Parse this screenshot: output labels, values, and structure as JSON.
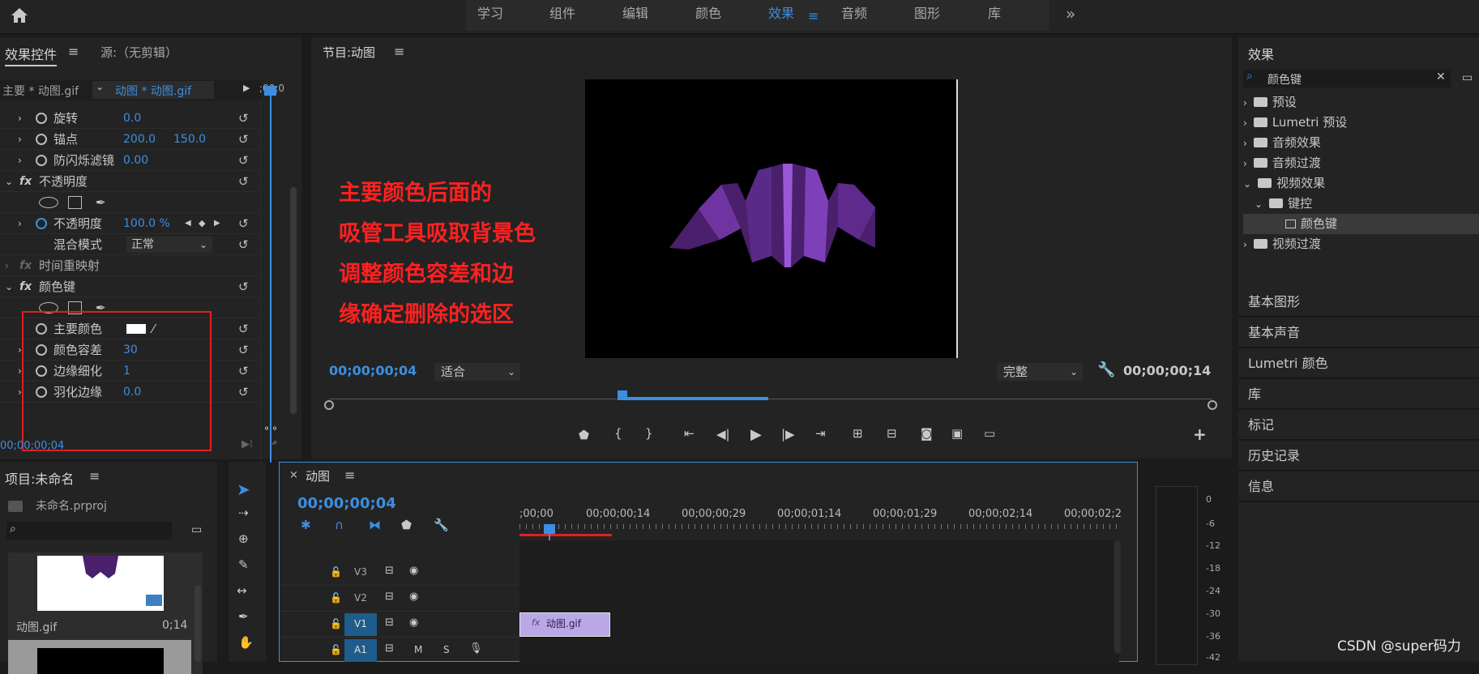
{
  "topbar": {
    "workspaces": [
      "学习",
      "组件",
      "编辑",
      "颜色",
      "效果",
      "音频",
      "图形",
      "库"
    ],
    "more": "»"
  },
  "effect_controls": {
    "tab_title": "效果控件",
    "source_title": "源:（无剪辑）",
    "master_clip": "主要 * 动图.gif",
    "sequence_clip": "动图 * 动图.gif",
    "time_ruler": ";00;0",
    "props": {
      "rotation_label": "旋转",
      "rotation": "0.0",
      "anchor_label": "锚点",
      "anchor_x": "200.0",
      "anchor_y": "150.0",
      "antiflicker_label": "防闪烁滤镜",
      "antiflicker": "0.00",
      "opacity_section": "不透明度",
      "opacity_label": "不透明度",
      "opacity": "100.0 %",
      "blend_label": "混合模式",
      "blend": "正常",
      "timeremap_section": "时间重映射",
      "colorkey_section": "颜色键",
      "key_color_label": "主要颜色",
      "tolerance_label": "颜色容差",
      "tolerance": "30",
      "edge_thin_label": "边缘细化",
      "edge_thin": "1",
      "feather_label": "羽化边缘",
      "feather": "0.0"
    },
    "timecode": "00;00;00;04",
    "fx": "fx"
  },
  "program": {
    "title": "节目:动图",
    "timecode_in": "00;00;00;04",
    "fit": "适合",
    "quality": "完整",
    "timecode_dur": "00;00;00;14"
  },
  "annotation": [
    "主要颜色后面的",
    "吸管工具吸取背景色",
    "调整颜色容差和边",
    "缘确定删除的选区"
  ],
  "project": {
    "title": "项目:未命名",
    "file": "未命名.prproj",
    "clip_name": "动图.gif",
    "clip_dur": "0;14"
  },
  "timeline": {
    "close": "×",
    "title": "动图",
    "timecode": "00;00;00;04",
    "ruler": [
      ";00;00",
      "00;00;00;14",
      "00;00;00;29",
      "00;00;01;14",
      "00;00;01;29",
      "00;00;02;14",
      "00;00;02;2"
    ],
    "tracks": [
      {
        "name": "V3"
      },
      {
        "name": "V2"
      },
      {
        "name": "V1"
      },
      {
        "name": "A1"
      }
    ],
    "clip_label": "动图.gif",
    "m": "M",
    "s": "S"
  },
  "meter": {
    "ticks": [
      "0",
      "-6",
      "-12",
      "-18",
      "-24",
      "-30",
      "-36",
      "-42"
    ]
  },
  "effects_panel": {
    "title": "效果",
    "search": "颜色键",
    "tree": [
      "预设",
      "Lumetri 预设",
      "音频效果",
      "音频过渡",
      "视频效果",
      "键控",
      "颜色键",
      "视频过渡"
    ],
    "sections": [
      "基本图形",
      "基本声音",
      "Lumetri 颜色",
      "库",
      "标记",
      "历史记录",
      "信息"
    ]
  },
  "watermark": "CSDN @super码力"
}
